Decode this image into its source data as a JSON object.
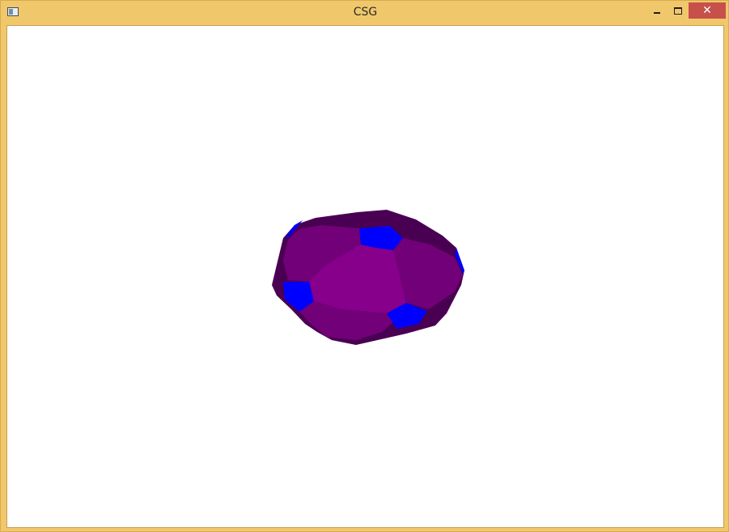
{
  "window": {
    "title": "CSG",
    "close_glyph": "✕"
  },
  "icons": {
    "app": "app-window-icon",
    "minimize": "minimize-icon",
    "maximize": "maximize-icon",
    "close": "close-icon"
  },
  "colors": {
    "titlebar": "#f0c76b",
    "close_button": "#c7504a",
    "viewport_background": "#ffffff",
    "face_dark": "#4a0052",
    "face_mid": "#720078",
    "face_light": "#86008c",
    "face_blue": "#0000ff"
  }
}
